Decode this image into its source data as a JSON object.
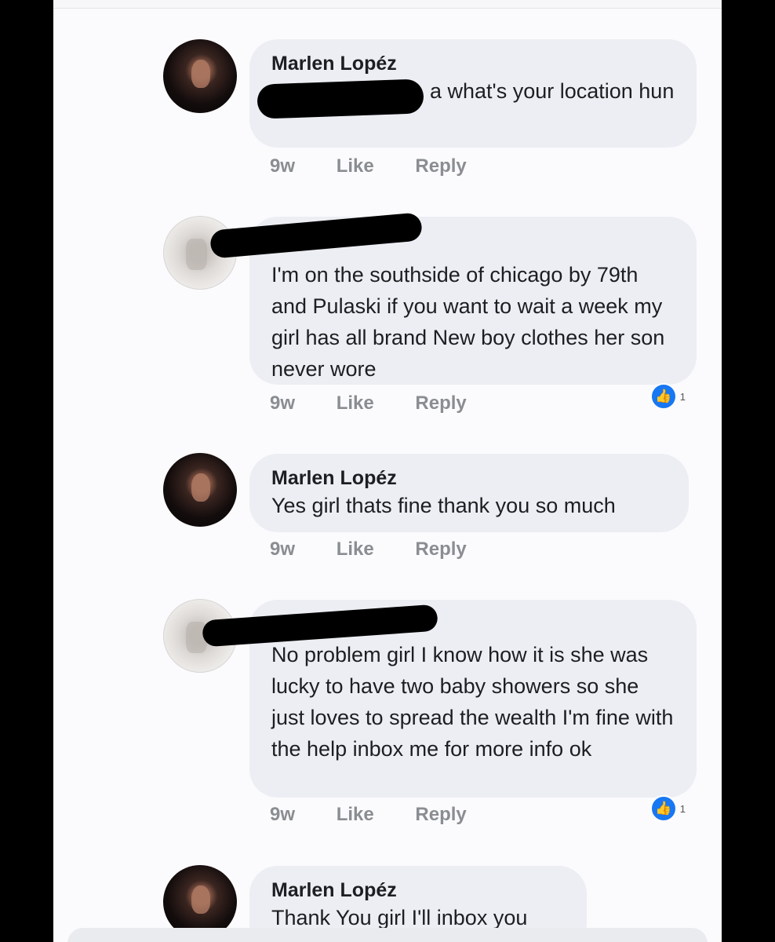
{
  "colors": {
    "bubble": "#eceef3",
    "text": "#1c1e21",
    "meta": "#8a8d91",
    "like": "#1877f2"
  },
  "comments": [
    {
      "author": "Marlen Lopéz",
      "text": "a what's your location hun",
      "time": "9w",
      "like_label": "Like",
      "reply_label": "Reply"
    },
    {
      "author": "",
      "text": "I'm on the southside of chicago by 79th and Pulaski if you want to wait a week my girl has all brand New boy clothes her son never wore",
      "time": "9w",
      "like_label": "Like",
      "reply_label": "Reply",
      "reactions": "1"
    },
    {
      "author": "Marlen Lopéz",
      "text": "Yes girl thats fine thank you so much",
      "time": "9w",
      "like_label": "Like",
      "reply_label": "Reply"
    },
    {
      "author": "",
      "text": "No problem girl I know how it is she was lucky to have two baby showers so she just loves to spread the wealth I'm fine with the help inbox me for more info ok",
      "time": "9w",
      "like_label": "Like",
      "reply_label": "Reply",
      "reactions": "1"
    },
    {
      "author": "Marlen Lopéz",
      "text": "Thank You girl I'll inbox you"
    }
  ],
  "icons": {
    "like_badge": "thumbs-up-icon"
  }
}
